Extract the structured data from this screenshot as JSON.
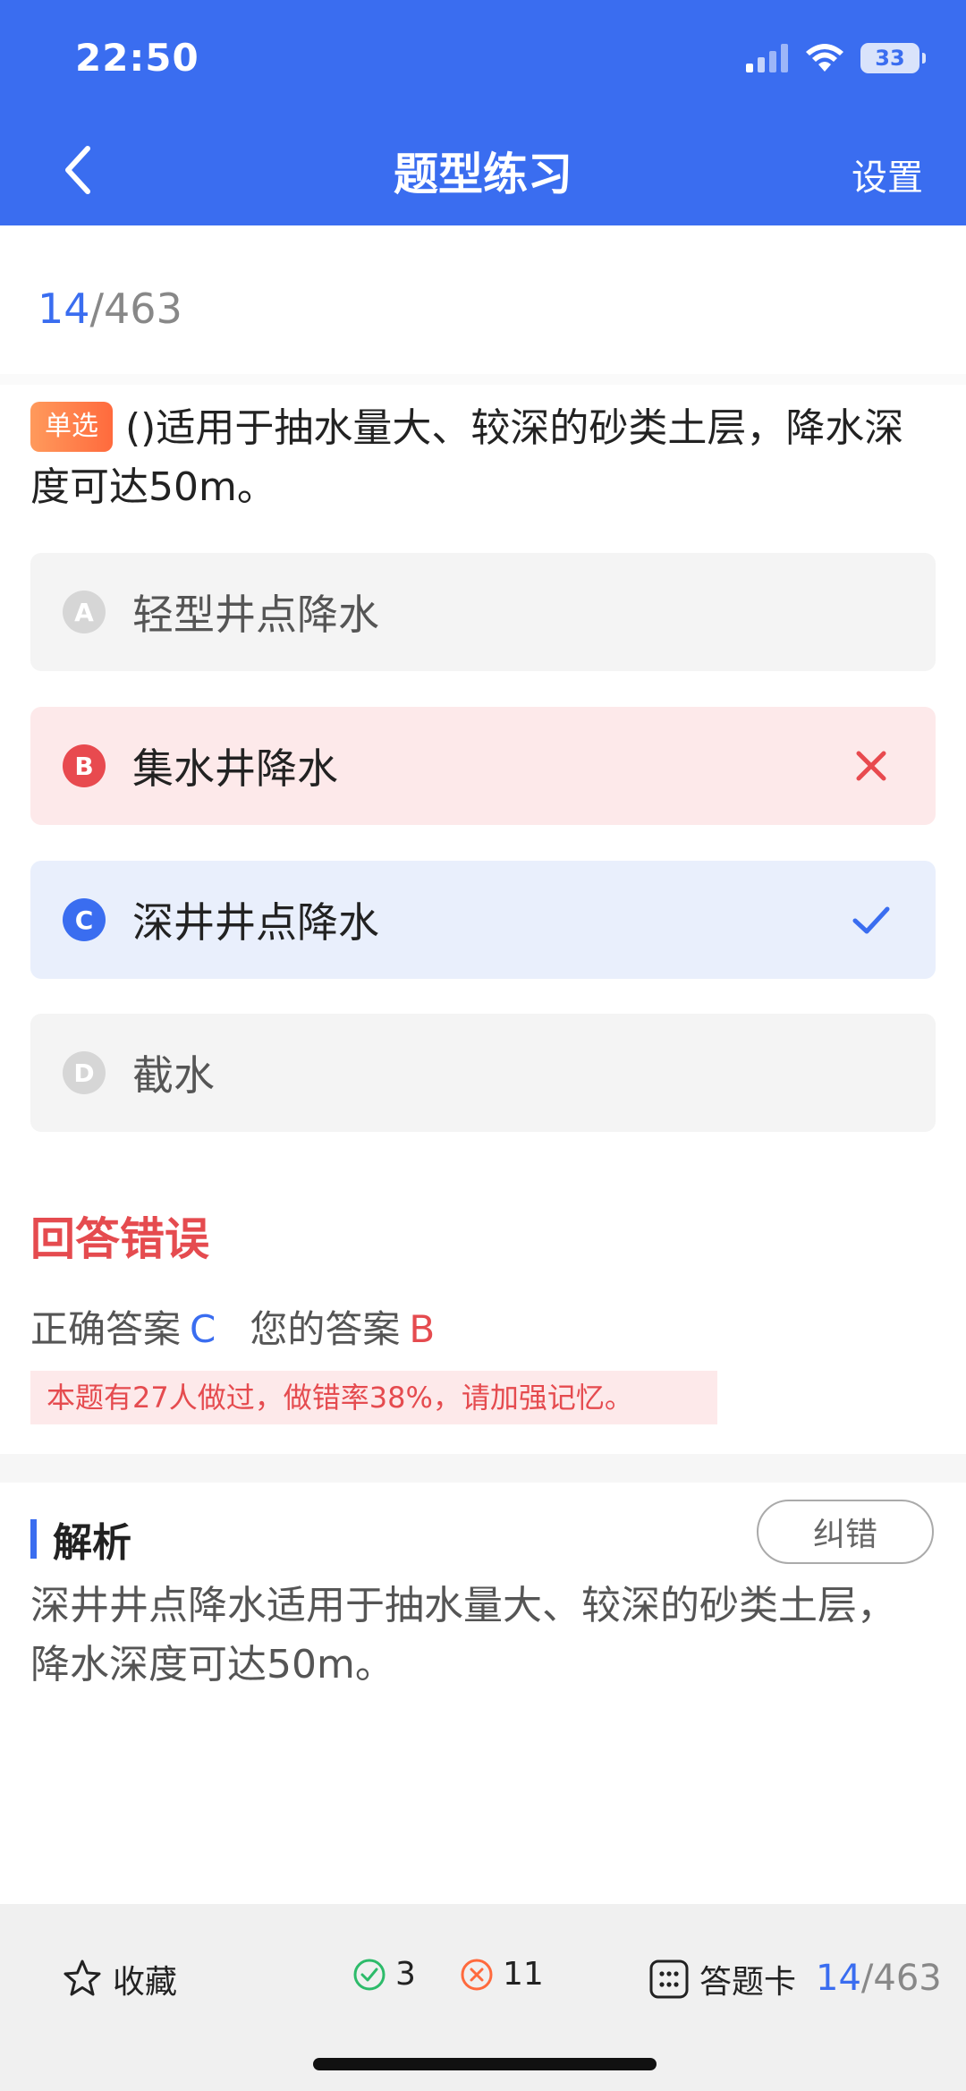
{
  "status_bar": {
    "time": "22:50",
    "battery": "33"
  },
  "header": {
    "title": "题型练习",
    "settings_label": "设置"
  },
  "progress": {
    "current": "14",
    "total": "/463"
  },
  "question": {
    "type_label": "单选",
    "text": "()适用于抽水量大、较深的砂类土层，降水深度可达50m。"
  },
  "options": [
    {
      "letter": "A",
      "text": "轻型井点降水",
      "state": "normal"
    },
    {
      "letter": "B",
      "text": "集水井降水",
      "state": "wrong"
    },
    {
      "letter": "C",
      "text": "深井井点降水",
      "state": "correct"
    },
    {
      "letter": "D",
      "text": "截水",
      "state": "normal"
    }
  ],
  "result": {
    "title": "回答错误",
    "correct_label": "正确答案",
    "correct_value": "C",
    "user_label": "您的答案",
    "user_value": "B",
    "stat_text": "本题有27人做过，做错率38%，请加强记忆。"
  },
  "analysis": {
    "title": "解析",
    "report_label": "纠错",
    "text": "深井井点降水适用于抽水量大、较深的砂类土层，降水深度可达50m。"
  },
  "bottom_bar": {
    "favorite_label": "收藏",
    "right_count": "3",
    "wrong_count": "11",
    "answer_card_label": "答题卡",
    "progress_current": "14",
    "progress_total": "/463"
  },
  "colors": {
    "primary": "#3a6df0",
    "error": "#e54b4f",
    "success": "#2dbb6a",
    "tag_orange": "#ff6a3d"
  }
}
